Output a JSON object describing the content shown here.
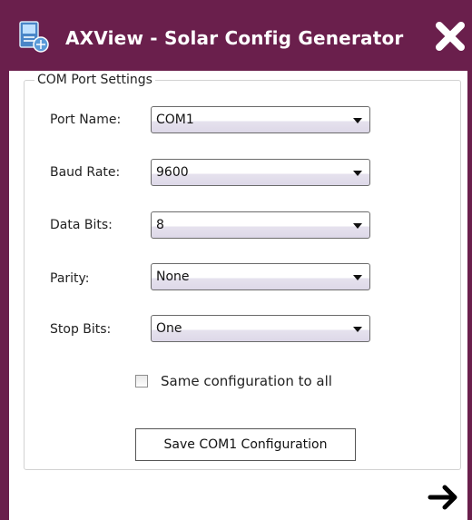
{
  "window": {
    "title": "AXView - Solar Config Generator",
    "accent_color": "#6a1f4c",
    "app_icon": "app-icon",
    "close_icon": "close-icon"
  },
  "com_group": {
    "legend": "COM Port Settings",
    "fields": {
      "port_name": {
        "label": "Port Name:",
        "value": "COM1"
      },
      "baud_rate": {
        "label": "Baud Rate:",
        "value": "9600"
      },
      "data_bits": {
        "label": "Data Bits:",
        "value": "8"
      },
      "parity": {
        "label": "Parity:",
        "value": "None"
      },
      "stop_bits": {
        "label": "Stop Bits:",
        "value": "One"
      }
    },
    "same_config": {
      "label": "Same configuration to all",
      "checked": false
    },
    "save_button": "Save COM1 Configuration"
  },
  "nav": {
    "next_icon": "arrow-right-icon"
  }
}
